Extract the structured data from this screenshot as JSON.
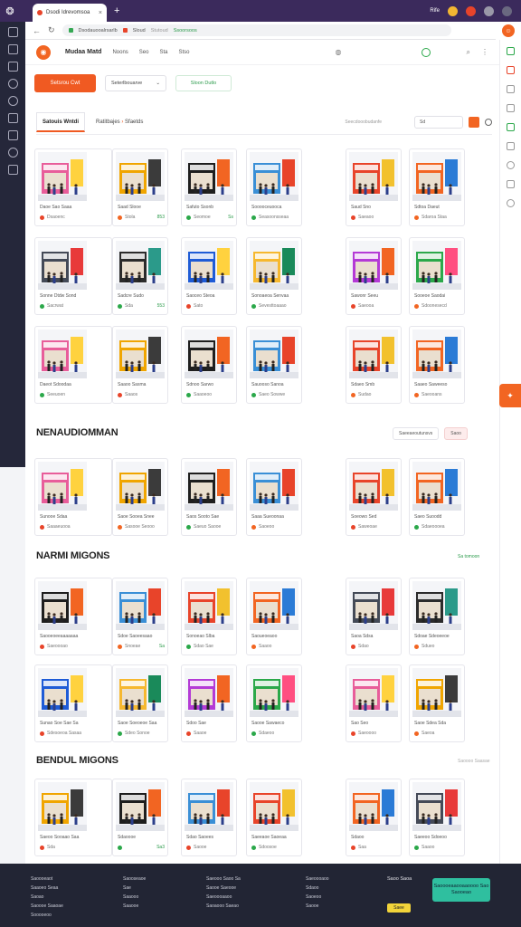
{
  "browser": {
    "tab_title": "Dsodi Idrevomsoa",
    "url_segments": [
      "Dsodauooalrsarlb",
      "Sloud",
      "Stutoud",
      "Ssoorsoos"
    ],
    "top_right_label": "Rife"
  },
  "site": {
    "brand": "Mudaa Matd",
    "nav": [
      "Noons",
      "Seo",
      "Sta",
      "Stso"
    ]
  },
  "filters": {
    "primary_button": "Setsrou Cwt",
    "dropdown_value": "Seterlbouarve",
    "secondary_button": "Sloon Dutlo"
  },
  "tabs": {
    "active": "Satouis Wntdi",
    "breadcrumb_a": "Ratitbajes",
    "breadcrumb_b": "Sfaetds",
    "tools_label": "Seecdooobudanfe",
    "segment_label": "Sd"
  },
  "section_top": {
    "cards": [
      {
        "name": "Daoe Sao Saaa",
        "meta": "Dsaoenc",
        "val": "",
        "dot": "#e8442a"
      },
      {
        "name": "Saad Slooe",
        "meta": "Stola",
        "val": "853",
        "dot": "#f26522"
      },
      {
        "name": "Safuto Ssonb",
        "meta": "Seomoe",
        "val": "Ss",
        "dot": "#2ba84a"
      },
      {
        "name": "Sooooceuooca",
        "meta": "Seasoonsseaa",
        "val": "",
        "dot": "#2ba84a"
      },
      {
        "name": "Saud Sno",
        "meta": "Saeaoo",
        "val": "",
        "dot": "#e8442a"
      },
      {
        "name": "Sdtoa Daeut",
        "meta": "Sdaroa Staa",
        "val": "",
        "dot": "#f26522"
      },
      {
        "name": "Sonne Dtdw Sond",
        "meta": "Sacrwat",
        "val": "",
        "dot": "#2ba84a"
      },
      {
        "name": "Sadcre Sudo",
        "meta": "Sda",
        "val": "553",
        "dot": "#2ba84a"
      },
      {
        "name": "Saoceo Steoa",
        "meta": "Sato",
        "val": "",
        "dot": "#e8442a"
      },
      {
        "name": "Sonoaeoa Senvaa",
        "meta": "Sevesttoaaao",
        "val": "",
        "dot": "#2ba84a"
      },
      {
        "name": "Sawonr Seeu",
        "meta": "Saeooa",
        "val": "",
        "dot": "#e8442a"
      },
      {
        "name": "Sooeoe Saodai",
        "meta": "Sdoonesecd",
        "val": "",
        "dot": "#f26522"
      },
      {
        "name": "Daeot Sdoodaa",
        "meta": "Seeuoen",
        "val": "",
        "dot": "#2ba84a"
      },
      {
        "name": "Saaoo Sasma",
        "meta": "Saaos",
        "val": "",
        "dot": "#e8442a"
      },
      {
        "name": "Sdnoo Sarwo",
        "meta": "Saaoeoo",
        "val": "",
        "dot": "#2ba84a"
      },
      {
        "name": "Sauooso Sanoa",
        "meta": "Saeo Sowwe",
        "val": "",
        "dot": "#2ba84a"
      },
      {
        "name": "Sdaeo Smb",
        "meta": "Sudao",
        "val": "",
        "dot": "#f26522"
      },
      {
        "name": "Saaeo Saweeso",
        "meta": "Saeooans",
        "val": "",
        "dot": "#f26522"
      }
    ]
  },
  "section_two": {
    "title": "NENAUDIOMMAN",
    "control_a": "Saeeaeoutunsvs",
    "control_b": "Saoo",
    "cards": [
      {
        "name": "Sunooe Sdaa",
        "meta": "Saaaeuooa",
        "val": "",
        "dot": "#e8442a"
      },
      {
        "name": "Saoe Sooea Snee",
        "meta": "Sasooe Seooo",
        "val": "",
        "dot": "#f26522"
      },
      {
        "name": "Saos Sooto Sae",
        "meta": "Saeuo Saooe",
        "val": "",
        "dot": "#2ba84a"
      },
      {
        "name": "Saaa Sueoonaa",
        "meta": "Saoeoo",
        "val": "",
        "dot": "#f26522"
      },
      {
        "name": "Soeowo Sed",
        "meta": "Saweoae",
        "val": "",
        "dot": "#e8442a"
      },
      {
        "name": "Saeo Suoodd",
        "meta": "Sdaeoooea",
        "val": "",
        "dot": "#2ba84a"
      }
    ]
  },
  "section_three": {
    "title": "NARMI MIGONS",
    "link": "Sa tomoon",
    "cards": [
      {
        "name": "Saooeoeeaaaaaaa",
        "meta": "Saeoooao",
        "val": "",
        "dot": "#e8442a"
      },
      {
        "name": "Sdoe Saoeesaao",
        "meta": "Snoeae",
        "val": "Sa",
        "dot": "#f26522"
      },
      {
        "name": "Sonoeao Slba",
        "meta": "Sdao Sae",
        "val": "",
        "dot": "#2ba84a"
      },
      {
        "name": "Saoueoeaoo",
        "meta": "Saaoo",
        "val": "",
        "dot": "#f26522"
      },
      {
        "name": "Saoa Sdsa",
        "meta": "Sdao",
        "val": "",
        "dot": "#e8442a"
      },
      {
        "name": "Sdoae Sdeoeeoe",
        "meta": "Sdueo",
        "val": "",
        "dot": "#f26522"
      },
      {
        "name": "Sunao Soe Sae Sa",
        "meta": "Sdesoeoa Sasaa",
        "val": "",
        "dot": "#e8442a"
      },
      {
        "name": "Saoe Soeoeoe Saa",
        "meta": "Sdeo Sonoe",
        "val": "",
        "dot": "#2ba84a"
      },
      {
        "name": "Sdoo Sae",
        "meta": "Saaoe",
        "val": "",
        "dot": "#e8442a"
      },
      {
        "name": "Saooe Sawaeco",
        "meta": "Sdaeoo",
        "val": "",
        "dot": "#2ba84a"
      },
      {
        "name": "Sao Seo",
        "meta": "Saeoooo",
        "val": "",
        "dot": "#e8442a"
      },
      {
        "name": "Saoe Sdea Sda",
        "meta": "Saeoa",
        "val": "",
        "dot": "#f26522"
      }
    ]
  },
  "section_four": {
    "title": "BENDUL MIGONS",
    "link": "Saoooo Saasae",
    "cards": [
      {
        "name": "Saeoo Sooaao Saa",
        "meta": "Sda",
        "val": "",
        "dot": "#e8442a"
      },
      {
        "name": "Sdaoooe",
        "meta": "",
        "val": "Sa3",
        "dot": "#2ba84a"
      },
      {
        "name": "Sdao Saoees",
        "meta": "Saooe",
        "val": "",
        "dot": "#e8442a"
      },
      {
        "name": "Saeeaoe Saoeaa",
        "meta": "Sdoosoe",
        "val": "",
        "dot": "#2ba84a"
      },
      {
        "name": "Sdaoo",
        "meta": "Saa",
        "val": "",
        "dot": "#e8442a"
      },
      {
        "name": "Saeeoo Sdoeoo",
        "meta": "Saaoo",
        "val": "",
        "dot": "#2ba84a"
      }
    ]
  },
  "footer": {
    "col1": [
      "Saoooeaot",
      "Saaoeo Seaa",
      "Saoao",
      "Saoooe Saaoae",
      "Sooooeoo"
    ],
    "col2": [
      "Saooseaoe",
      "Sae",
      "Saaooo",
      "Saaooe"
    ],
    "col3": [
      "Saeooo Saoo Sa",
      "Saooe Saeooe",
      "Saeoooaaoo",
      "Saoaooo Saeao"
    ],
    "col4": [
      "Saeoooaoo",
      "Sdaoo",
      "Saoeoo",
      "Saooe"
    ],
    "col5_title": "Saoo Saoa",
    "cta": "Saoooeaaooaaoooo Sao Saooeao",
    "badge": "Saee"
  }
}
